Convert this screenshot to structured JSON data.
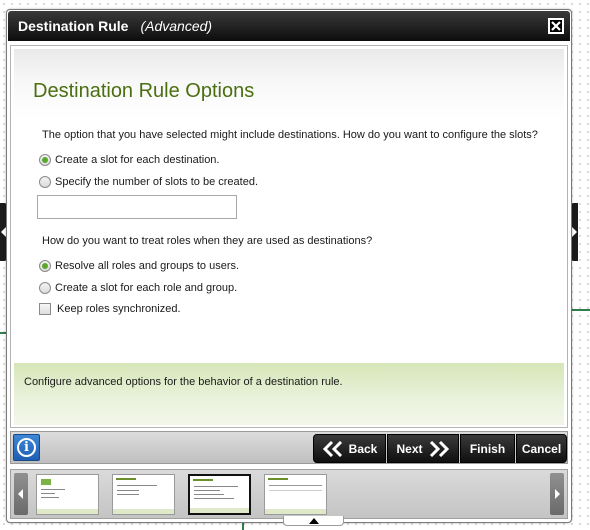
{
  "dialog": {
    "title": "Destination Rule",
    "subtitle": "(Advanced)"
  },
  "page": {
    "heading": "Destination Rule Options",
    "slots_question": "The option that you have selected might include destinations. How do you want to configure the slots?",
    "slot_options": [
      {
        "label": "Create a slot for each destination.",
        "selected": true
      },
      {
        "label": "Specify the number of slots to be created.",
        "selected": false
      }
    ],
    "slot_count_value": "",
    "roles_question": "How do you want to treat roles when they are used as destinations?",
    "role_options": [
      {
        "label": "Resolve all roles and groups to users.",
        "selected": true
      },
      {
        "label": "Create a slot for each role and group.",
        "selected": false
      }
    ],
    "keep_synced": {
      "label": "Keep roles synchronized.",
      "checked": false
    },
    "help_text": "Configure advanced options for the behavior of a destination rule."
  },
  "toolbar": {
    "info_glyph": "i",
    "back_label": "Back",
    "next_label": "Next",
    "finish_label": "Finish",
    "cancel_label": "Cancel"
  },
  "thumbnails": {
    "count": 4,
    "selected_index": 2
  },
  "colors": {
    "heading_green": "#4a6e10",
    "radio_selected": "#5aa72c",
    "help_band": "#dfeac8",
    "titlebar": "#111111",
    "info_blue": "#2c6fc2"
  }
}
